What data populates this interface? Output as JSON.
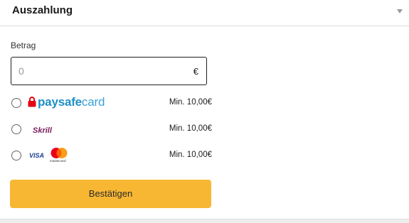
{
  "header": {
    "title": "Auszahlung",
    "caret_icon": "chevron-down-icon"
  },
  "form": {
    "amount_label": "Betrag",
    "amount_placeholder": "0",
    "currency_symbol": "€"
  },
  "options": [
    {
      "id": "paysafecard",
      "logo": {
        "brand_main": "paysafe",
        "brand_tail": "card"
      },
      "min": "Min. 10,00€"
    },
    {
      "id": "skrill",
      "logo": {
        "brand": "Skrill"
      },
      "min": "Min. 10,00€"
    },
    {
      "id": "card",
      "logo": {
        "visa": "VISA",
        "mc_caption": "mastercard"
      },
      "min": "Min. 10,00€"
    }
  ],
  "confirm_label": "Bestätigen",
  "colors": {
    "accent": "#f8b733",
    "paysafe_blue": "#1d8fc7",
    "paysafe_red": "#e30613",
    "skrill": "#7a1a5b"
  }
}
